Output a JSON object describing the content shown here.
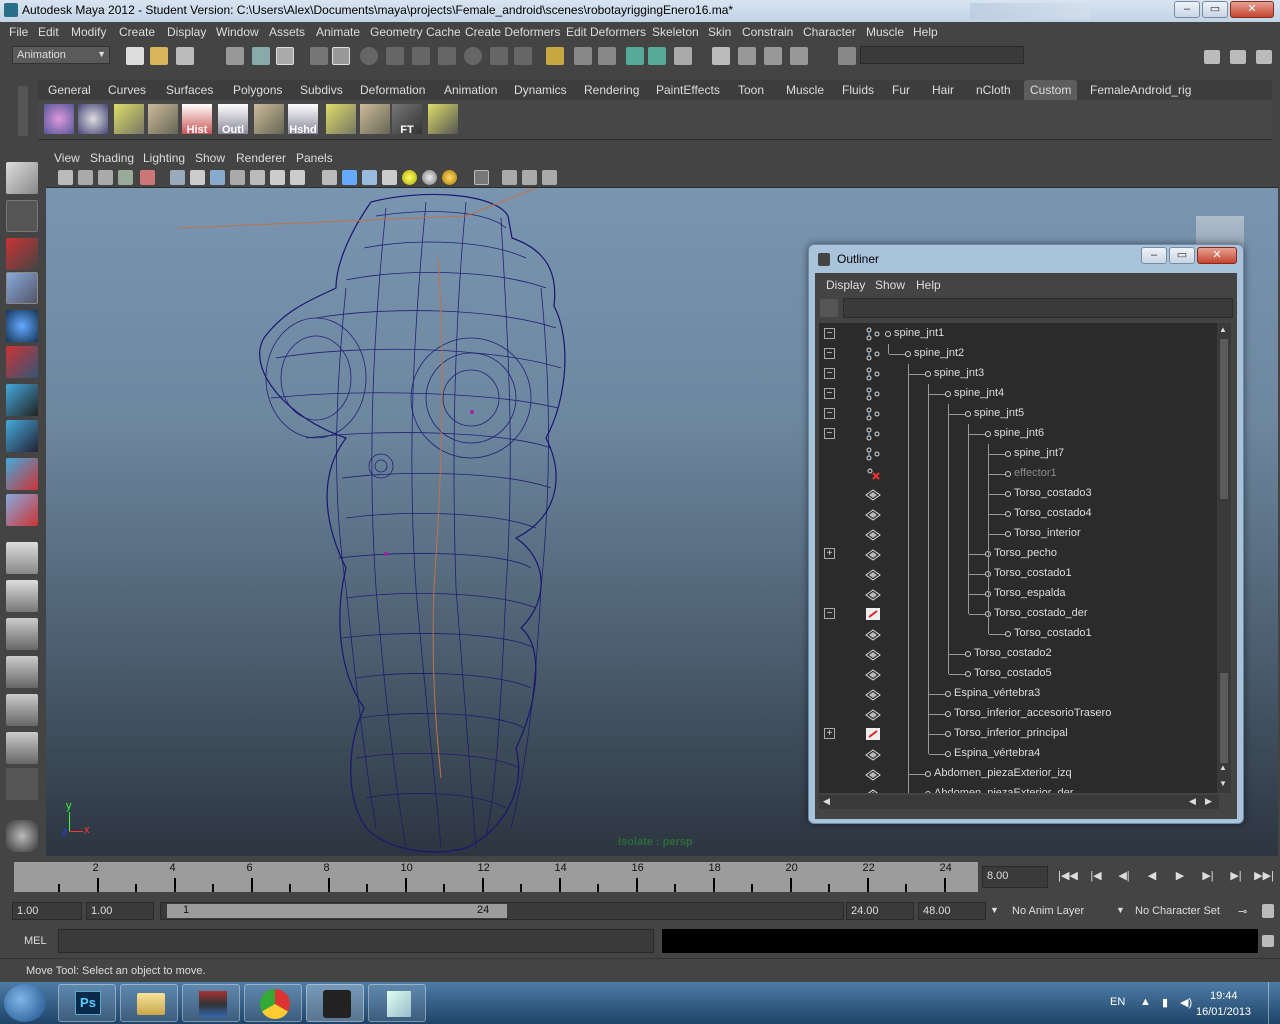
{
  "window": {
    "title": "Autodesk Maya 2012 - Student Version: C:\\Users\\Alex\\Documents\\maya\\projects\\Female_android\\scenes\\robotayriggingEnero16.ma*",
    "minimize": "–",
    "maximize": "▭",
    "close": "✕"
  },
  "menubar": [
    "File",
    "Edit",
    "Modify",
    "Create",
    "Display",
    "Window",
    "Assets",
    "Animate",
    "Geometry Cache",
    "Create Deformers",
    "Edit Deformers",
    "Skeleton",
    "Skin",
    "Constrain",
    "Character",
    "Muscle",
    "Help"
  ],
  "statusline": {
    "mode": "Animation"
  },
  "shelf": {
    "tabs": [
      "General",
      "Curves",
      "Surfaces",
      "Polygons",
      "Subdivs",
      "Deformation",
      "Animation",
      "Dynamics",
      "Rendering",
      "PaintEffects",
      "Toon",
      "Muscle",
      "Fluids",
      "Fur",
      "Hair",
      "nCloth",
      "Custom",
      "FemaleAndroid_rig"
    ],
    "active_tab": "Custom",
    "icon_labels": {
      "hist": "Hist",
      "outl": "Outl",
      "hshd": "Hshd",
      "ft": "FT"
    }
  },
  "viewport": {
    "menu": [
      "View",
      "Shading",
      "Lighting",
      "Show",
      "Renderer",
      "Panels"
    ],
    "isolate_label": "Isolate : persp",
    "axis": {
      "y": "y",
      "z": "z",
      "x": "x"
    }
  },
  "outliner": {
    "title": "Outliner",
    "menu": [
      "Display",
      "Show",
      "Help"
    ],
    "items": [
      {
        "name": "spine_jnt1",
        "depth": 0,
        "expander": "−",
        "icon": "joint"
      },
      {
        "name": "spine_jnt2",
        "depth": 1,
        "expander": "−",
        "icon": "joint"
      },
      {
        "name": "spine_jnt3",
        "depth": 2,
        "expander": "−",
        "icon": "joint"
      },
      {
        "name": "spine_jnt4",
        "depth": 3,
        "expander": "−",
        "icon": "joint"
      },
      {
        "name": "spine_jnt5",
        "depth": 4,
        "expander": "−",
        "icon": "joint"
      },
      {
        "name": "spine_jnt6",
        "depth": 5,
        "expander": "−",
        "icon": "joint"
      },
      {
        "name": "spine_jnt7",
        "depth": 6,
        "expander": "",
        "icon": "joint"
      },
      {
        "name": "effector1",
        "depth": 6,
        "expander": "",
        "icon": "effector",
        "dim": true
      },
      {
        "name": "Torso_costado3",
        "depth": 6,
        "expander": "",
        "icon": "mesh"
      },
      {
        "name": "Torso_costado4",
        "depth": 6,
        "expander": "",
        "icon": "mesh"
      },
      {
        "name": "Torso_interior",
        "depth": 6,
        "expander": "",
        "icon": "mesh"
      },
      {
        "name": "Torso_pecho",
        "depth": 5,
        "expander": "+",
        "icon": "mesh"
      },
      {
        "name": "Torso_costado1",
        "depth": 5,
        "expander": "",
        "icon": "mesh"
      },
      {
        "name": "Torso_espalda",
        "depth": 5,
        "expander": "",
        "icon": "mesh"
      },
      {
        "name": "Torso_costado_der",
        "depth": 5,
        "expander": "−",
        "icon": "group"
      },
      {
        "name": "Torso_costado1",
        "depth": 6,
        "expander": "",
        "icon": "mesh"
      },
      {
        "name": "Torso_costado2",
        "depth": 4,
        "expander": "",
        "icon": "mesh"
      },
      {
        "name": "Torso_costado5",
        "depth": 4,
        "expander": "",
        "icon": "mesh"
      },
      {
        "name": "Espina_vértebra3",
        "depth": 3,
        "expander": "",
        "icon": "mesh"
      },
      {
        "name": "Torso_inferior_accesorioTrasero",
        "depth": 3,
        "expander": "",
        "icon": "mesh"
      },
      {
        "name": "Torso_inferior_principal",
        "depth": 3,
        "expander": "+",
        "icon": "group"
      },
      {
        "name": "Espina_vértebra4",
        "depth": 3,
        "expander": "",
        "icon": "mesh"
      },
      {
        "name": "Abdomen_piezaExterior_izq",
        "depth": 2,
        "expander": "",
        "icon": "mesh"
      },
      {
        "name": "Abdomen_piezaExterior_der",
        "depth": 2,
        "expander": "",
        "icon": "mesh"
      }
    ]
  },
  "timeslider": {
    "ticks": [
      "2",
      "4",
      "6",
      "8",
      "10",
      "12",
      "14",
      "16",
      "18",
      "20",
      "22",
      "24"
    ],
    "current_frame": "8.00"
  },
  "range": {
    "start": "1.00",
    "playback_start": "1.00",
    "range_min": "1",
    "range_max": "24",
    "playback_end": "24.00",
    "end": "48.00",
    "anim_layer": "No Anim Layer",
    "character_set": "No Character Set"
  },
  "commandline": {
    "label": "MEL"
  },
  "helpline": {
    "text": "Move Tool: Select an object to move."
  },
  "taskbar": {
    "lang": "EN",
    "time": "19:44",
    "date": "16/01/2013",
    "ps_label": "Ps"
  }
}
